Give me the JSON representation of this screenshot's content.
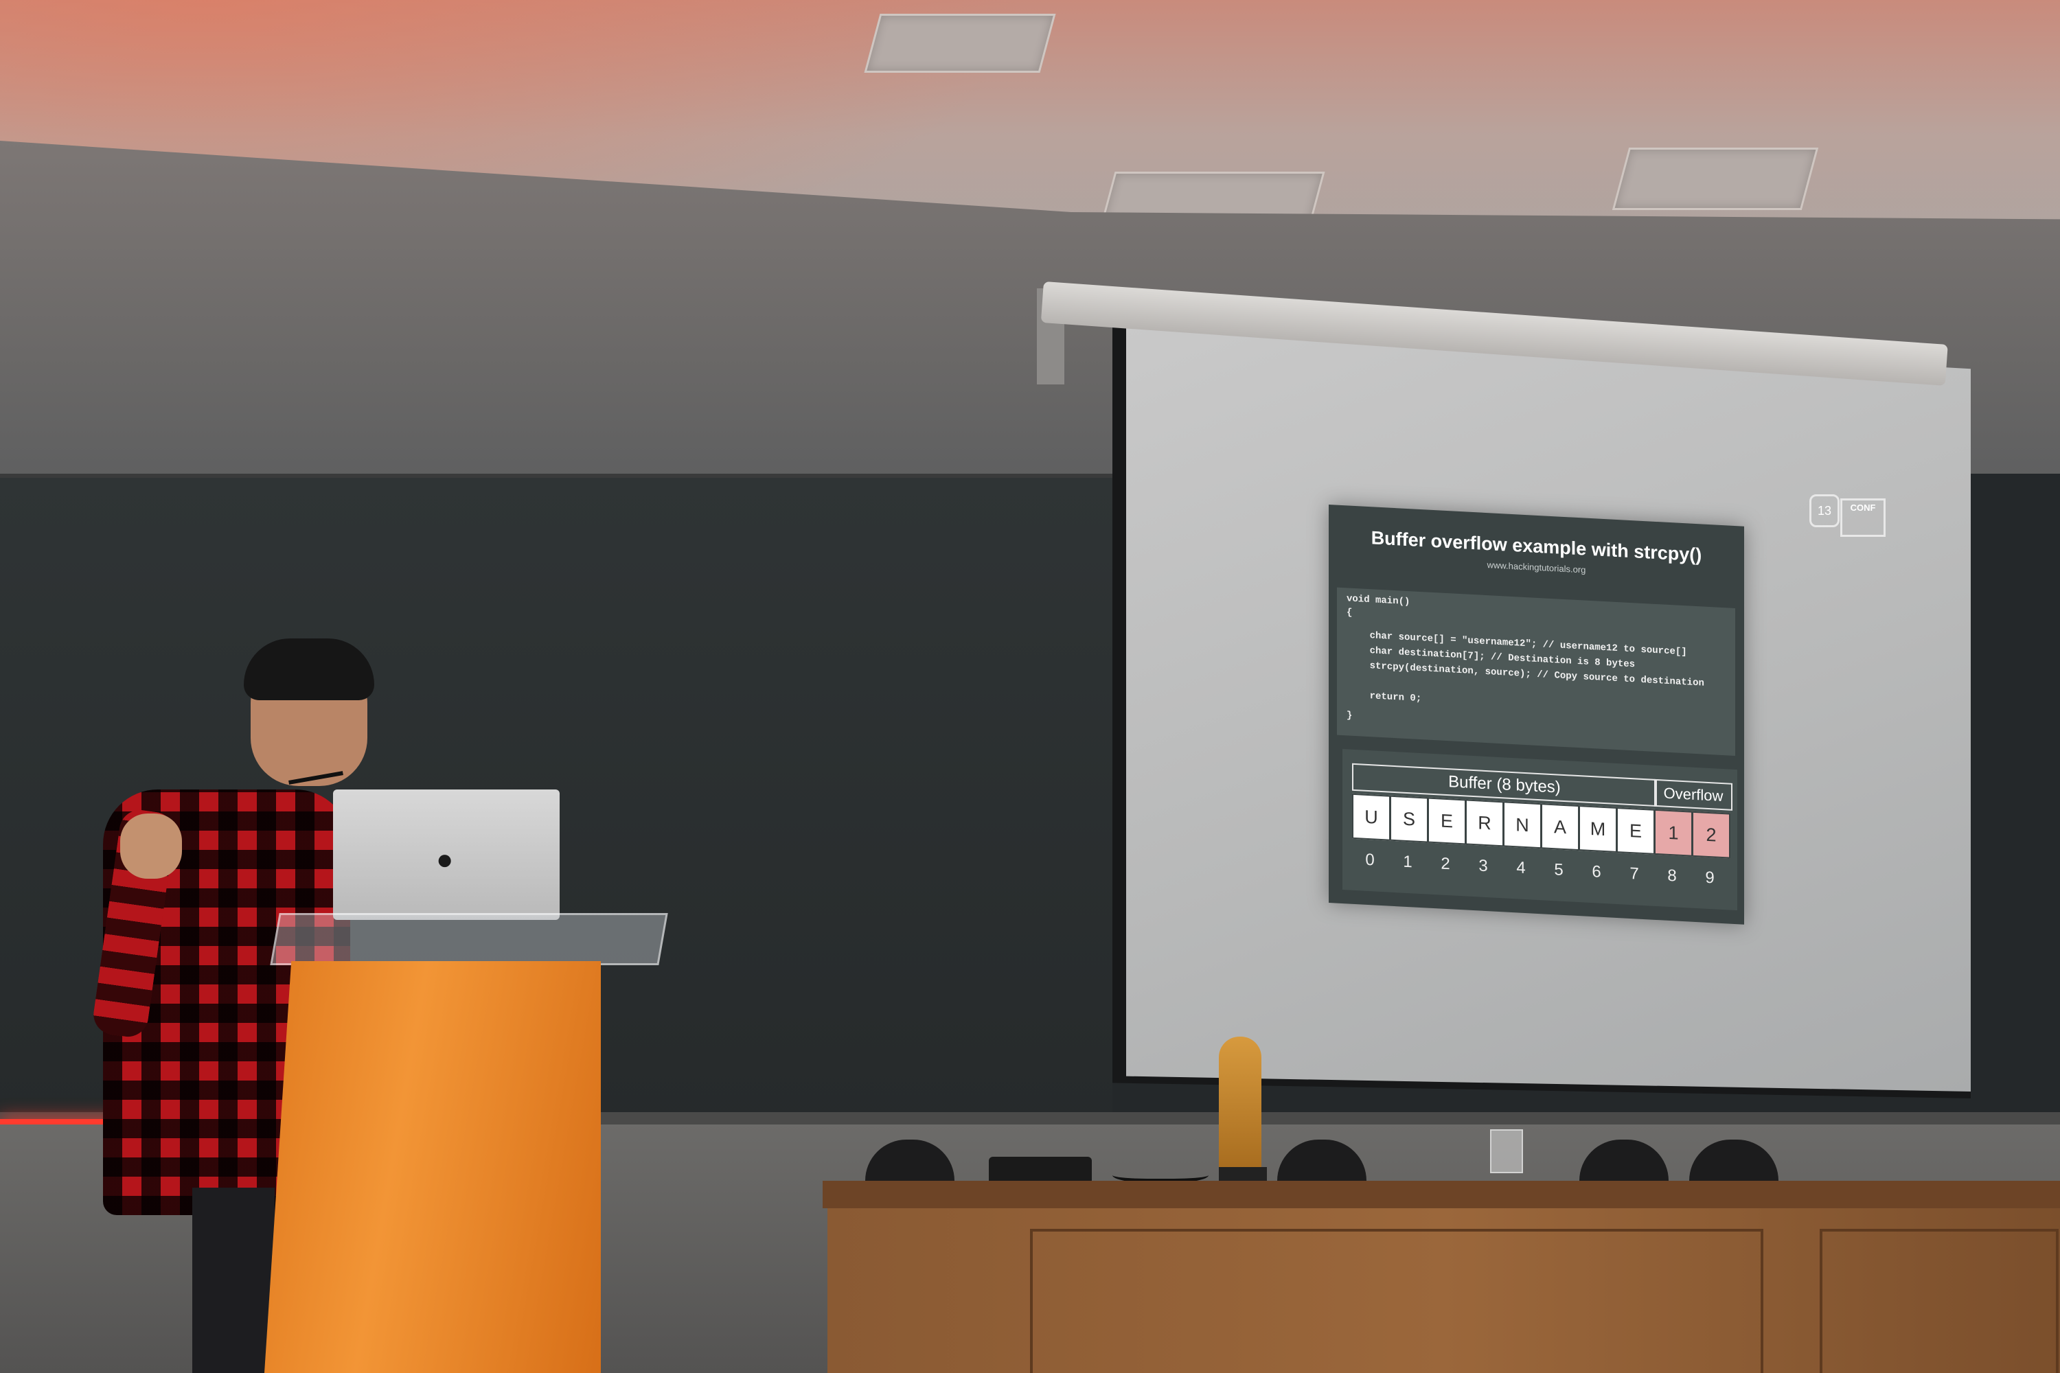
{
  "slide": {
    "title": "Buffer overflow example with strcpy()",
    "url": "www.hackingtutorials.org",
    "code": [
      "void main()",
      "{",
      "    char source[] = \"username12\"; // username12 to source[]",
      "    char destination[7]; // Destination is 8 bytes",
      "    strcpy(destination, source); // Copy source to destination",
      "",
      "    return 0;",
      "}"
    ],
    "buffer_label": "Buffer (8 bytes)",
    "overflow_label": "Overflow",
    "cells": [
      "U",
      "S",
      "E",
      "R",
      "N",
      "A",
      "M",
      "E",
      "1",
      "2"
    ],
    "indices": [
      "0",
      "1",
      "2",
      "3",
      "4",
      "5",
      "6",
      "7",
      "8",
      "9"
    ],
    "overflow_color": "#e6a8a8"
  },
  "logo": {
    "conf_text": "CONF"
  },
  "colors": {
    "podium": "#f29536",
    "shirt": "#b5151b",
    "red_light": "#ff3b2e"
  }
}
